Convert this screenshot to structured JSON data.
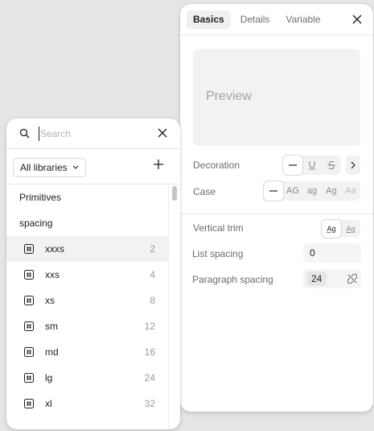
{
  "typography_panel": {
    "tabs": [
      {
        "label": "Basics",
        "active": true
      },
      {
        "label": "Details",
        "active": false
      },
      {
        "label": "Variable",
        "active": false
      }
    ],
    "preview_text": "Preview",
    "decoration_label": "Decoration",
    "decoration_options": [
      "none",
      "underline",
      "strikethrough"
    ],
    "decoration_selected": "none",
    "case_label": "Case",
    "case_options": [
      "—",
      "AG",
      "ag",
      "Ag",
      "Aa"
    ],
    "case_selected": "—",
    "vertical_trim_label": "Vertical trim",
    "vertical_trim_options": [
      "Ag",
      "Ag"
    ],
    "list_spacing_label": "List spacing",
    "list_spacing_value": "0",
    "paragraph_spacing_label": "Paragraph spacing",
    "paragraph_spacing_value": "24"
  },
  "variable_picker": {
    "search_placeholder": "Search",
    "library_select": "All libraries",
    "collection": "Primitives",
    "group": "spacing",
    "tokens": [
      {
        "name": "xxxs",
        "value": "2",
        "highlighted": true
      },
      {
        "name": "xxs",
        "value": "4"
      },
      {
        "name": "xs",
        "value": "8"
      },
      {
        "name": "sm",
        "value": "12"
      },
      {
        "name": "md",
        "value": "16"
      },
      {
        "name": "lg",
        "value": "24"
      },
      {
        "name": "xl",
        "value": "32"
      }
    ]
  }
}
